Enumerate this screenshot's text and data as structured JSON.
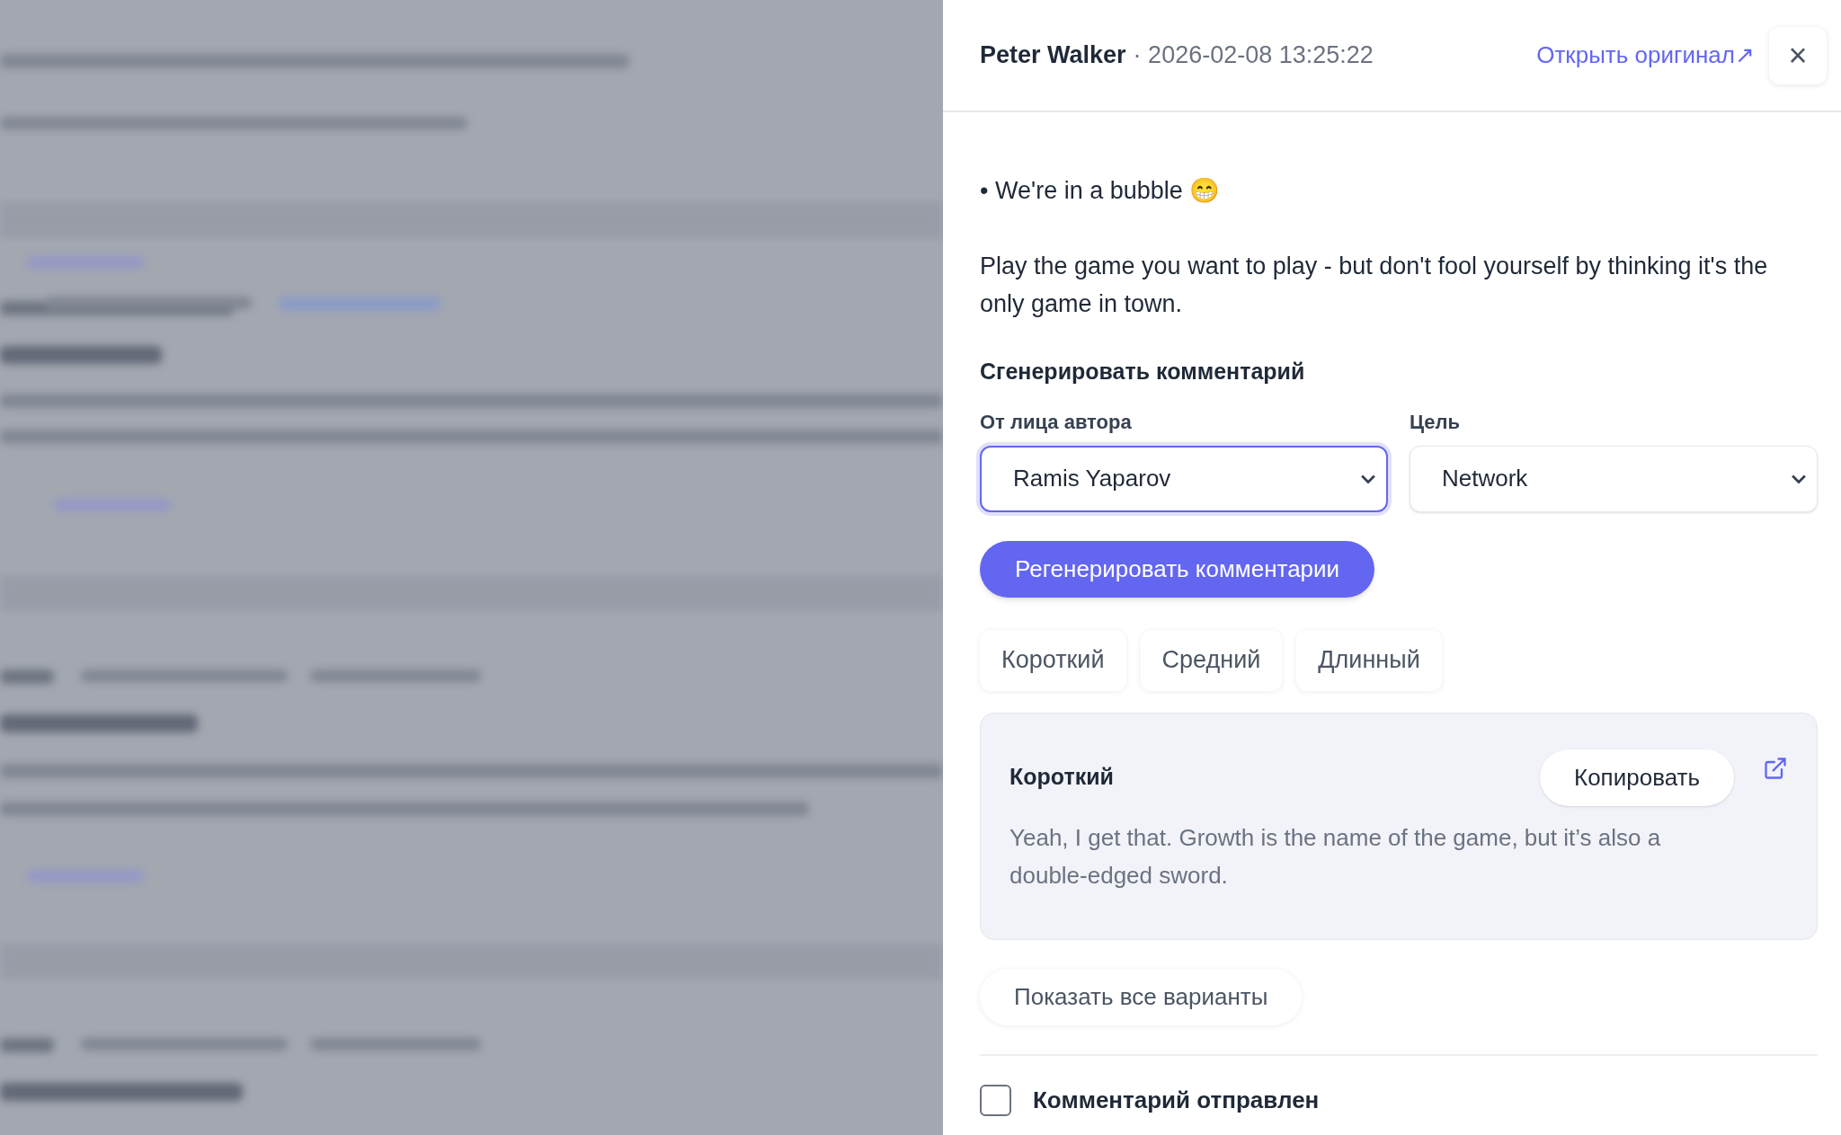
{
  "drawer": {
    "author": "Peter Walker",
    "separator": "·",
    "timestamp": "2026-02-08 13:25:22",
    "open_original_link": "Открыть оригинал↗",
    "close": "×"
  },
  "post": {
    "paragraphs": [
      {
        "kind": "bullet",
        "bullet": "•",
        "text": "We're in a bubble 😁"
      },
      {
        "kind": "text",
        "text": "Play the game you want to play - but don't fool yourself by thinking it's the only game in town."
      }
    ]
  },
  "generator": {
    "title": "Сгенерировать комментарий",
    "fields": [
      {
        "label": "От лица автора",
        "value": "Ramis Yaparov",
        "focused": true
      },
      {
        "label": "Цель",
        "value": "Network",
        "focused": false
      }
    ],
    "regenerate_button": "Регенерировать комментарии",
    "length_tabs": [
      {
        "label": "Короткий",
        "selected": false
      },
      {
        "label": "Средний",
        "selected": false
      },
      {
        "label": "Длинный",
        "selected": false
      }
    ],
    "result": {
      "title": "Короткий",
      "copy_button": "Копировать",
      "text": "Yeah, I get that. Growth is the name of the game, but it’s also a double-edged sword."
    },
    "show_all_button": "Показать все варианты",
    "sent": {
      "label": "Комментарий отправлен",
      "checked": false
    }
  }
}
